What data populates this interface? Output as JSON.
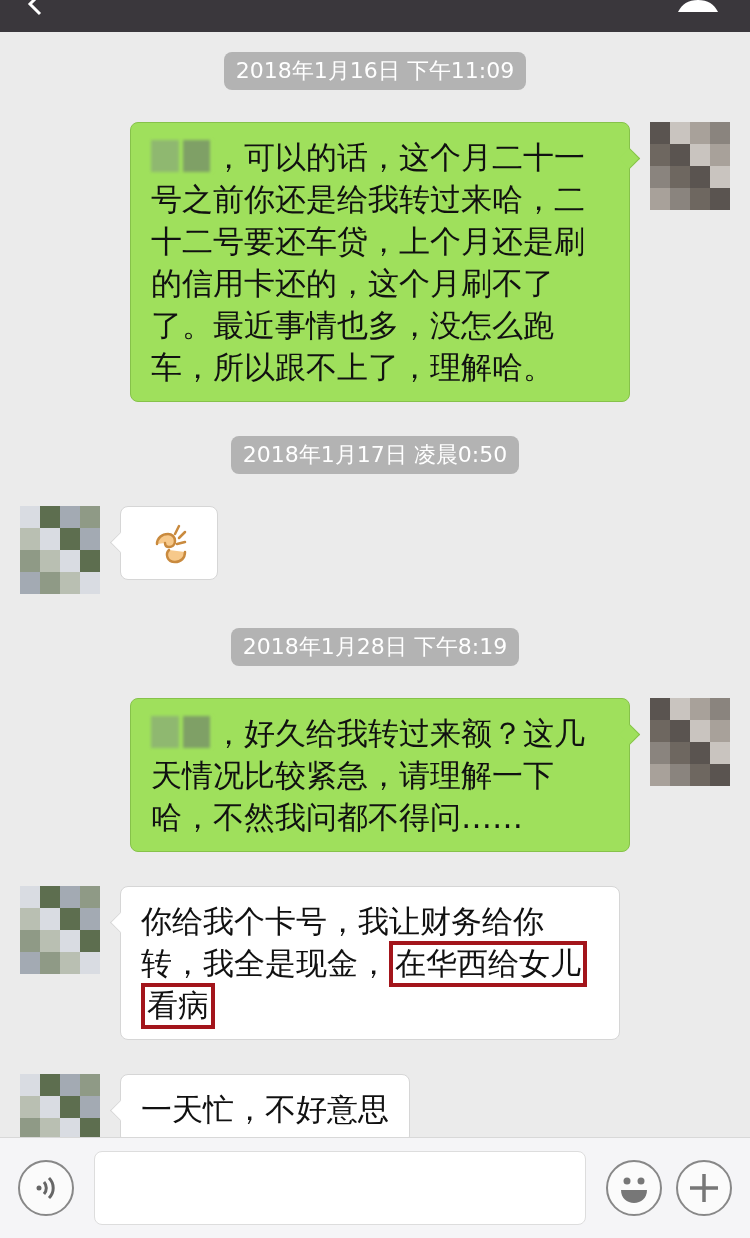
{
  "chat": [
    {
      "kind": "time",
      "text": "2018年1月16日 下午11:09"
    },
    {
      "kind": "sent",
      "segments": [
        {
          "kind": "redacted"
        },
        {
          "kind": "text",
          "text": "，可以的话，这个月二十一号之前你还是给我转过来哈，二十二号要还车贷，上个月还是刷的信用卡还的，这个月刷不了了。最近事情也多，没怎么跑车，所以跟不上了，理解哈。",
          "highlighted": false
        }
      ]
    },
    {
      "kind": "time",
      "text": "2018年1月17日 凌晨0:50"
    },
    {
      "kind": "received",
      "segments": [
        {
          "kind": "emoji"
        }
      ]
    },
    {
      "kind": "time",
      "text": "2018年1月28日 下午8:19"
    },
    {
      "kind": "sent",
      "segments": [
        {
          "kind": "redacted"
        },
        {
          "kind": "text",
          "text": "，好久给我转过来额？这几天情况比较紧急，请理解一下哈，不然我问都不得问……",
          "highlighted": false
        }
      ]
    },
    {
      "kind": "received",
      "segments": [
        {
          "kind": "text",
          "text": "你给我个卡号，我让财务给你转，我全是现金，",
          "highlighted": false
        },
        {
          "kind": "text",
          "text": "在华西给女儿",
          "highlighted": true
        },
        {
          "kind": "text",
          "text": "看病",
          "highlighted": true
        }
      ]
    },
    {
      "kind": "received",
      "segments": [
        {
          "kind": "text",
          "text": "一天忙，不好意思",
          "highlighted": false
        }
      ]
    }
  ]
}
